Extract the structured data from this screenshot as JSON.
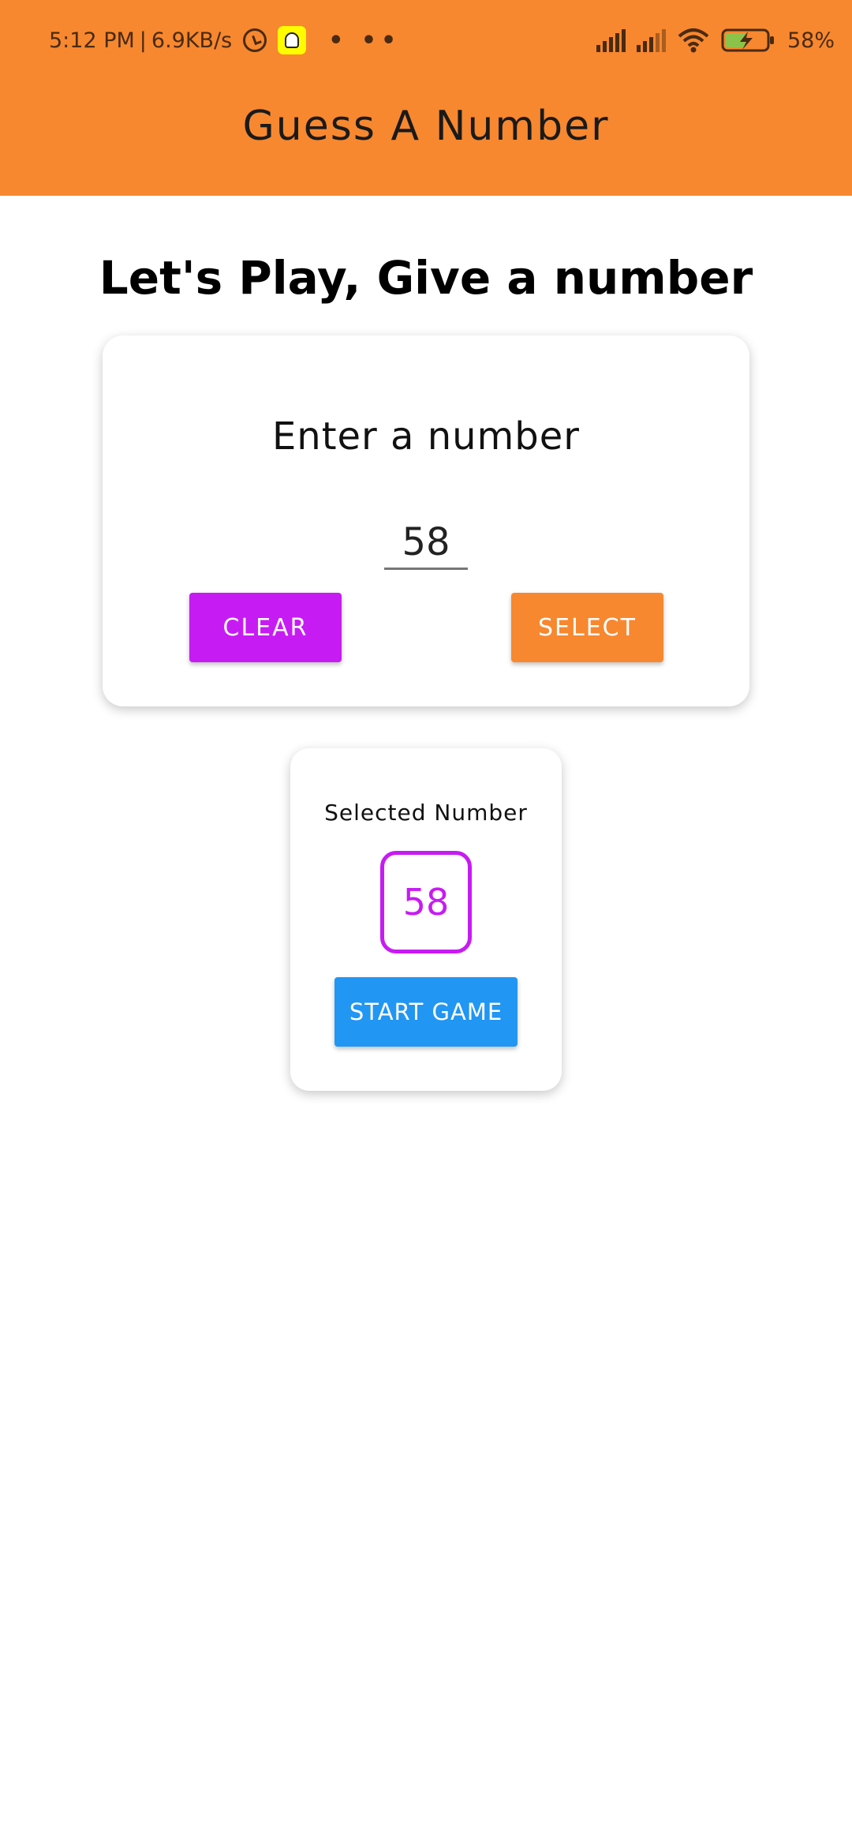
{
  "status_bar": {
    "time": "5:12 PM",
    "separator": "|",
    "net_speed": "6.9KB/s",
    "more": "• ••",
    "battery": "58%",
    "icons": [
      "alarm-icon",
      "snapchat-icon",
      "signal-icon",
      "signal-icon",
      "wifi-icon",
      "battery-charging-icon"
    ]
  },
  "app_bar": {
    "title": "Guess A Number"
  },
  "main": {
    "heading": "Let's Play, Give a number"
  },
  "input_card": {
    "title": "Enter a number",
    "input_value": "58",
    "clear_label": "CLEAR",
    "select_label": "SELECT"
  },
  "selected_card": {
    "label": "Selected Number",
    "number": "58",
    "start_label": "START GAME"
  },
  "colors": {
    "primary": "#F7882F",
    "accent": "#C71BF3",
    "start_button": "#2196F3",
    "background": "#FFFFFF"
  }
}
